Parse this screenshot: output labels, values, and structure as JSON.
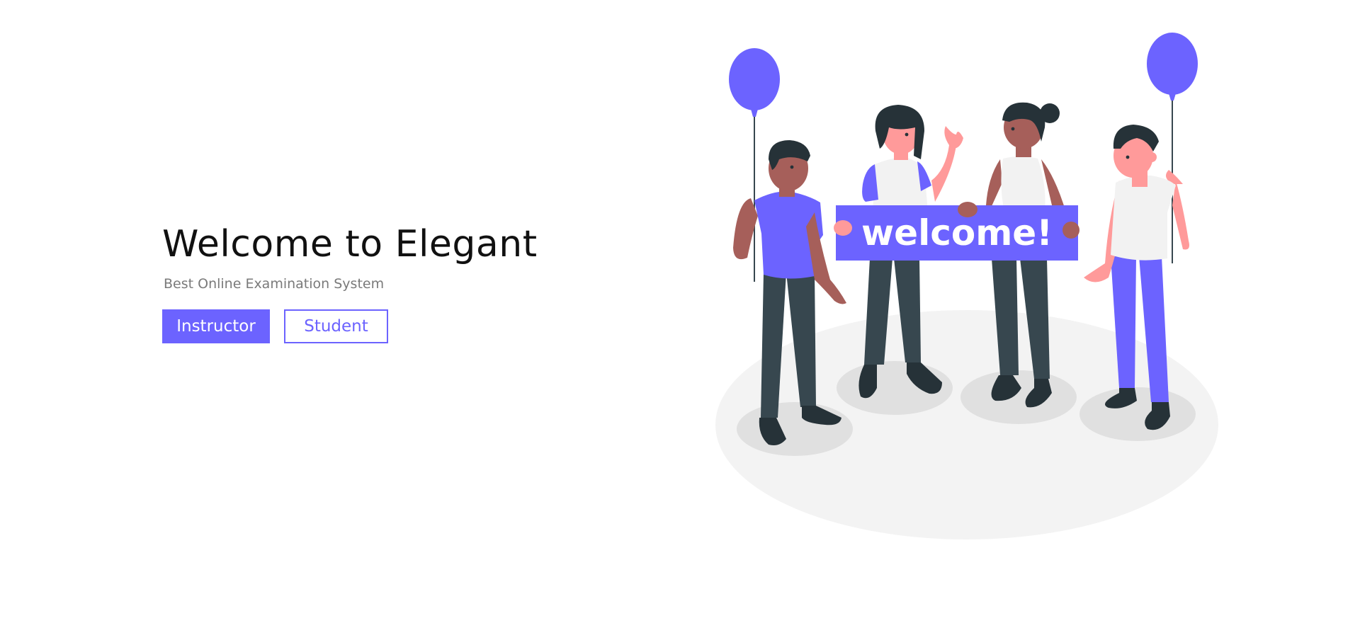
{
  "hero": {
    "title": "Welcome to Elegant",
    "subtitle": "Best Online Examination System",
    "buttons": {
      "instructor_label": "Instructor",
      "student_label": "Student"
    }
  },
  "illustration": {
    "banner_text": "welcome!"
  },
  "colors": {
    "accent": "#6c63ff",
    "dark": "#37474f",
    "ground": "#f3f3f3"
  }
}
